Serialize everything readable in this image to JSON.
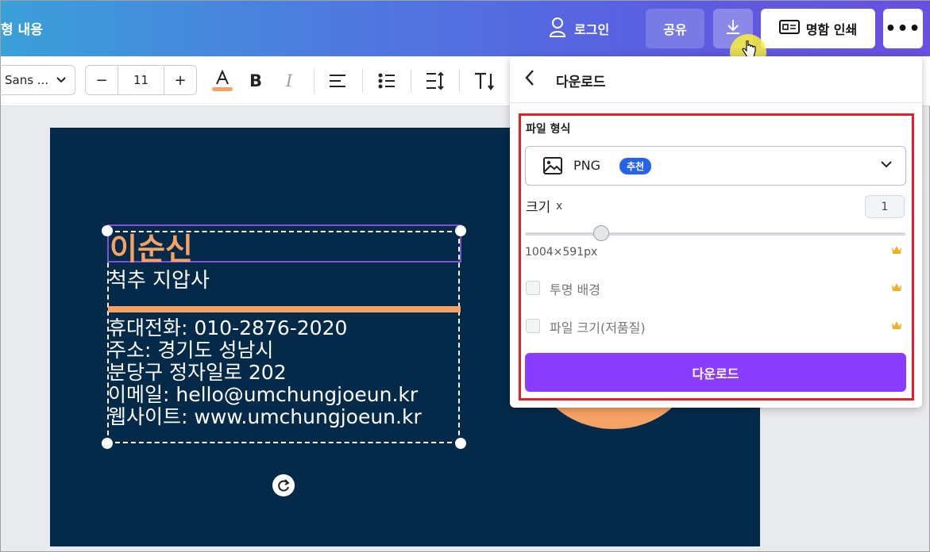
{
  "header": {
    "doc_title": "형 내용",
    "login_label": "로그인",
    "share_label": "공유",
    "print_label": "명함 인쇄",
    "more_label": "•••"
  },
  "toolbar": {
    "font_name": "Sans ...",
    "font_size": "11",
    "minus": "−",
    "plus": "+",
    "text_color": "#f6a264"
  },
  "card": {
    "name": "이순신",
    "job": "척추 지압사",
    "contact_lines": [
      "휴대전화: 010-2876-2020",
      "주소: 경기도 성남시",
      "분당구 정자일로 202",
      "이메일: hello@umchungjoeun.kr",
      "웹사이트: www.umchungjoeun.kr"
    ],
    "bg_color": "#042a4a",
    "accent_color": "#f6a264"
  },
  "download_panel": {
    "title": "다운로드",
    "file_type_label": "파일 형식",
    "file_type_value": "PNG",
    "recommended_badge": "추천",
    "size_label": "크기",
    "size_x": "x",
    "size_value": "1",
    "size_slider_fraction": 0.2,
    "dimensions": "1004×591px",
    "transparent_bg_label": "투명 배경",
    "file_size_label": "파일 크기(저품질)",
    "download_button": "다운로드",
    "button_color": "#8b3dff",
    "highlight_color": "#e0202a"
  }
}
